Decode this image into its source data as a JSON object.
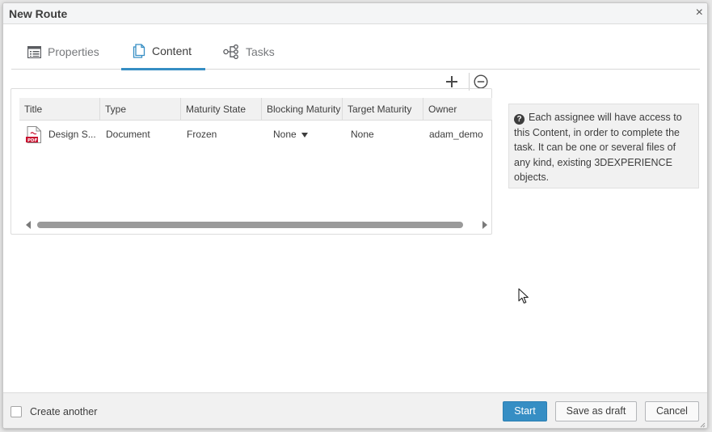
{
  "dialog": {
    "title": "New Route",
    "close_symbol": "×"
  },
  "tabs": [
    {
      "label": "Properties",
      "icon": "properties-icon",
      "active": false
    },
    {
      "label": "Content",
      "icon": "document-icon",
      "active": true
    },
    {
      "label": "Tasks",
      "icon": "tasks-flow-icon",
      "active": false
    }
  ],
  "toolbar": {
    "add_icon": "plus-icon",
    "remove_icon": "minus-circle-icon"
  },
  "table": {
    "headers": [
      "Title",
      "Type",
      "Maturity State",
      "Blocking Maturity",
      "Target Maturity",
      "Owner"
    ],
    "rows": [
      {
        "title": "Design S...",
        "file_icon": "pdf-icon",
        "type": "Document",
        "maturity_state": "Frozen",
        "blocking_maturity": "None",
        "target_maturity": "None",
        "owner": "adam_demo"
      }
    ]
  },
  "info": {
    "text": "Each assignee will have access to this Content, in order to complete the task. It can be one or several files of any kind, existing 3DEXPERIENCE objects."
  },
  "footer": {
    "create_another_label": "Create another",
    "create_another_checked": false,
    "start_label": "Start",
    "save_draft_label": "Save as draft",
    "cancel_label": "Cancel"
  },
  "colors": {
    "accent": "#368ec4",
    "text": "#3d3d3d",
    "pdf_red": "#c8102e"
  }
}
